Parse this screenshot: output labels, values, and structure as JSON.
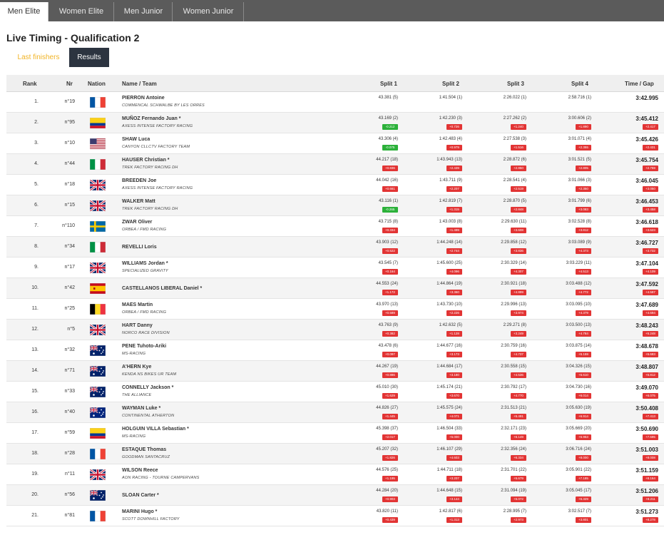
{
  "tabs": [
    "Men Elite",
    "Women Elite",
    "Men Junior",
    "Women Junior"
  ],
  "active_tab": 0,
  "title": "Live Timing - Qualification 2",
  "subtabs": {
    "last_finishers": "Last finishers",
    "results": "Results"
  },
  "colors": {
    "accent_yellow": "#f1b426",
    "dark_button": "#2c3440",
    "gap_red": "#e23434",
    "gap_green": "#2cb13a",
    "tabbar": "#5b5b5b"
  },
  "headers": {
    "rank": "Rank",
    "nr": "Nr",
    "nation": "Nation",
    "name_team": "Name / Team",
    "split1": "Split 1",
    "split2": "Split 2",
    "split3": "Split 3",
    "split4": "Split 4",
    "time_gap": "Time / Gap"
  },
  "rows": [
    {
      "rank": "1.",
      "nr": "n°19",
      "flag": "fr",
      "name": "PIERRON Antoine",
      "team": "COMMENCAL SCHWALBE BY LES ORRES",
      "s1": "43.381 (5)",
      "d1": "",
      "s2": "1:41.504 (1)",
      "d2": "",
      "s3": "2:26.022 (1)",
      "d3": "",
      "s4": "2:58.716 (1)",
      "d4": "",
      "time": "3:42.995",
      "gap": ""
    },
    {
      "rank": "2.",
      "nr": "n°95",
      "flag": "co",
      "name": "MUÑOZ Fernando Juan *",
      "team": "AXESS INTENSE FACTORY RACING",
      "s1": "43.169 (2)",
      "d1": "-0.212",
      "s2": "1:42.230 (3)",
      "d2": "+0.726",
      "s3": "2:27.262 (2)",
      "d3": "+1.240",
      "s4": "3:00.606 (2)",
      "d4": "+1.890",
      "time": "3:45.412",
      "gap": "+2.417"
    },
    {
      "rank": "3.",
      "nr": "n°10",
      "flag": "us",
      "name": "SHAW Luca",
      "team": "CANYON CLLCTV FACTORY TEAM",
      "s1": "43.306 (4)",
      "d1": "-0.075",
      "s2": "1:42.483 (4)",
      "d2": "+0.979",
      "s3": "2:27.538 (3)",
      "d3": "+1.516",
      "s4": "3:01.071 (4)",
      "d4": "+2.355",
      "time": "3:45.426",
      "gap": "+2.431"
    },
    {
      "rank": "4.",
      "nr": "n°44",
      "flag": "it",
      "name": "HAUSER Christian *",
      "team": "TREK FACTORY RACING DH",
      "s1": "44.217 (18)",
      "d1": "+0.836",
      "s2": "1:43.943 (13)",
      "d2": "+2.439",
      "s3": "2:28.872 (6)",
      "d3": "+2.850",
      "s4": "3:01.521 (5)",
      "d4": "+2.805",
      "time": "3:45.754",
      "gap": "+2.759"
    },
    {
      "rank": "5.",
      "nr": "n°18",
      "flag": "gb",
      "name": "BREEDEN Joe",
      "team": "AXESS INTENSE FACTORY RACING",
      "s1": "44.042 (16)",
      "d1": "+0.661",
      "s2": "1:43.711 (9)",
      "d2": "+2.207",
      "s3": "2:28.541 (4)",
      "d3": "+2.519",
      "s4": "3:01.066 (3)",
      "d4": "+2.350",
      "time": "3:46.045",
      "gap": "+3.050"
    },
    {
      "rank": "6.",
      "nr": "n°15",
      "flag": "gb",
      "name": "WALKER Matt",
      "team": "TREK FACTORY RACING DH",
      "s1": "43.116 (1)",
      "d1": "-0.265",
      "s2": "1:42.819 (7)",
      "d2": "+1.315",
      "s3": "2:28.870 (5)",
      "d3": "+2.848",
      "s4": "3:01.799 (6)",
      "d4": "+3.083",
      "time": "3:46.453",
      "gap": "+3.458"
    },
    {
      "rank": "7.",
      "nr": "n°110",
      "flag": "se",
      "name": "ZWAR Oliver",
      "team": "ORBEA / FMD RACING",
      "s1": "43.715 (8)",
      "d1": "+0.334",
      "s2": "1:43.003 (8)",
      "d2": "+1.499",
      "s3": "2:29.630 (11)",
      "d3": "+3.608",
      "s4": "3:02.528 (8)",
      "d4": "+3.812",
      "time": "3:46.618",
      "gap": "+3.623"
    },
    {
      "rank": "8.",
      "nr": "n°34",
      "flag": "it",
      "name": "REVELLI Loris",
      "team": "",
      "s1": "43.903 (12)",
      "d1": "+0.522",
      "s2": "1:44.248 (14)",
      "d2": "+2.744",
      "s3": "2:29.858 (12)",
      "d3": "+3.836",
      "s4": "3:03.089 (9)",
      "d4": "+4.373",
      "time": "3:46.727",
      "gap": "+3.732"
    },
    {
      "rank": "9.",
      "nr": "n°17",
      "flag": "gb",
      "name": "WILLIAMS Jordan *",
      "team": "SPECIALIZED GRAVITY",
      "s1": "43.545 (7)",
      "d1": "+0.164",
      "s2": "1:45.600 (25)",
      "d2": "+4.096",
      "s3": "2:30.329 (14)",
      "d3": "+4.307",
      "s4": "3:03.229 (11)",
      "d4": "+4.513",
      "time": "3:47.104",
      "gap": "+4.109"
    },
    {
      "rank": "10.",
      "nr": "n°42",
      "flag": "es",
      "name": "CASTELLANOS LIBERAL Daniel *",
      "team": "",
      "s1": "44.553 (24)",
      "d1": "+1.172",
      "s2": "1:44.864 (19)",
      "d2": "+3.360",
      "s3": "2:30.921 (18)",
      "d3": "+4.899",
      "s4": "3:03.488 (12)",
      "d4": "+4.772",
      "time": "3:47.592",
      "gap": "+4.597"
    },
    {
      "rank": "11.",
      "nr": "n°25",
      "flag": "be",
      "name": "MAES Martin",
      "team": "ORBEA / FMD RACING",
      "s1": "43.970 (13)",
      "d1": "+0.589",
      "s2": "1:43.730 (10)",
      "d2": "+2.226",
      "s3": "2:29.996 (13)",
      "d3": "+3.974",
      "s4": "3:03.095 (10)",
      "d4": "+4.379",
      "time": "3:47.689",
      "gap": "+4.694"
    },
    {
      "rank": "12.",
      "nr": "n°5",
      "flag": "gb",
      "name": "HART Danny",
      "team": "NORCO RACE DIVISION",
      "s1": "43.763 (9)",
      "d1": "+0.382",
      "s2": "1:42.632 (5)",
      "d2": "+1.128",
      "s3": "2:29.271 (8)",
      "d3": "+3.249",
      "s4": "3:03.500 (13)",
      "d4": "+4.784",
      "time": "3:48.243",
      "gap": "+5.248"
    },
    {
      "rank": "13.",
      "nr": "n°32",
      "flag": "au",
      "name": "PENE Tuhoto-Ariki",
      "team": "MS-RACING",
      "s1": "43.478 (6)",
      "d1": "+0.097",
      "s2": "1:44.677 (16)",
      "d2": "+3.173",
      "s3": "2:30.759 (16)",
      "d3": "+4.737",
      "s4": "3:03.875 (14)",
      "d4": "+5.159",
      "time": "3:48.678",
      "gap": "+5.683"
    },
    {
      "rank": "14.",
      "nr": "n°71",
      "flag": "au",
      "name": "A'HERN Kye",
      "team": "KENDA NS BIKES UR TEAM",
      "s1": "44.267 (19)",
      "d1": "+0.886",
      "s2": "1:44.684 (17)",
      "d2": "+3.180",
      "s3": "2:30.558 (15)",
      "d3": "+4.536",
      "s4": "3:04.326 (15)",
      "d4": "+5.610",
      "time": "3:48.807",
      "gap": "+5.812"
    },
    {
      "rank": "15.",
      "nr": "n°33",
      "flag": "au",
      "name": "CONNELLY Jackson *",
      "team": "THE ALLIANCE",
      "s1": "45.010 (30)",
      "d1": "+1.629",
      "s2": "1:45.174 (21)",
      "d2": "+3.670",
      "s3": "2:30.792 (17)",
      "d3": "+4.770",
      "s4": "3:04.730 (16)",
      "d4": "+6.014",
      "time": "3:49.070",
      "gap": "+6.075"
    },
    {
      "rank": "16.",
      "nr": "n°40",
      "flag": "nz",
      "name": "WAYMAN Luke *",
      "team": "CONTINENTAL ATHERTON",
      "s1": "44.826 (27)",
      "d1": "+1.445",
      "s2": "1:45.575 (24)",
      "d2": "+4.071",
      "s3": "2:31.513 (21)",
      "d3": "+5.491",
      "s4": "3:05.630 (19)",
      "d4": "+6.914",
      "time": "3:50.408",
      "gap": "+7.413"
    },
    {
      "rank": "17.",
      "nr": "n°59",
      "flag": "co",
      "name": "HOLGUIN VILLA Sebastian *",
      "team": "MS-RACING",
      "s1": "45.398 (37)",
      "d1": "+2.017",
      "s2": "1:46.504 (33)",
      "d2": "+5.000",
      "s3": "2:32.171 (23)",
      "d3": "+6.149",
      "s4": "3:05.669 (20)",
      "d4": "+6.953",
      "time": "3:50.690",
      "gap": "+7.695"
    },
    {
      "rank": "18.",
      "nr": "n°28",
      "flag": "fr",
      "name": "ESTAQUE Thomas",
      "team": "GOODMAN SANTACRUZ",
      "s1": "45.207 (32)",
      "d1": "+1.826",
      "s2": "1:46.107 (29)",
      "d2": "+4.603",
      "s3": "2:32.356 (24)",
      "d3": "+6.334",
      "s4": "3:06.716 (24)",
      "d4": "+8.000",
      "time": "3:51.003",
      "gap": "+8.008"
    },
    {
      "rank": "19.",
      "nr": "n°11",
      "flag": "gb",
      "name": "WILSON Reece",
      "team": "AON RACING - TOURNE CAMPERVANS",
      "s1": "44.576 (25)",
      "d1": "+1.195",
      "s2": "1:44.711 (18)",
      "d2": "+3.207",
      "s3": "2:31.701 (22)",
      "d3": "+5.679",
      "s4": "3:05.901 (22)",
      "d4": "+7.185",
      "time": "3:51.159",
      "gap": "+8.164"
    },
    {
      "rank": "20.",
      "nr": "n°56",
      "flag": "au",
      "name": "SLOAN Carter *",
      "team": "",
      "s1": "44.284 (20)",
      "d1": "+0.903",
      "s2": "1:44.648 (15)",
      "d2": "+3.144",
      "s3": "2:31.094 (19)",
      "d3": "+5.072",
      "s4": "3:05.045 (17)",
      "d4": "+6.329",
      "time": "3:51.206",
      "gap": "+8.211"
    },
    {
      "rank": "21.",
      "nr": "n°81",
      "flag": "fr",
      "name": "MARINI Hugo *",
      "team": "SCOTT DOWNHILL FACTORY",
      "s1": "43.820 (11)",
      "d1": "+0.439",
      "s2": "1:42.817 (6)",
      "d2": "+1.313",
      "s3": "2:28.995 (7)",
      "d3": "+2.973",
      "s4": "3:02.517 (7)",
      "d4": "+3.801",
      "time": "3:51.273",
      "gap": "+8.278"
    }
  ]
}
